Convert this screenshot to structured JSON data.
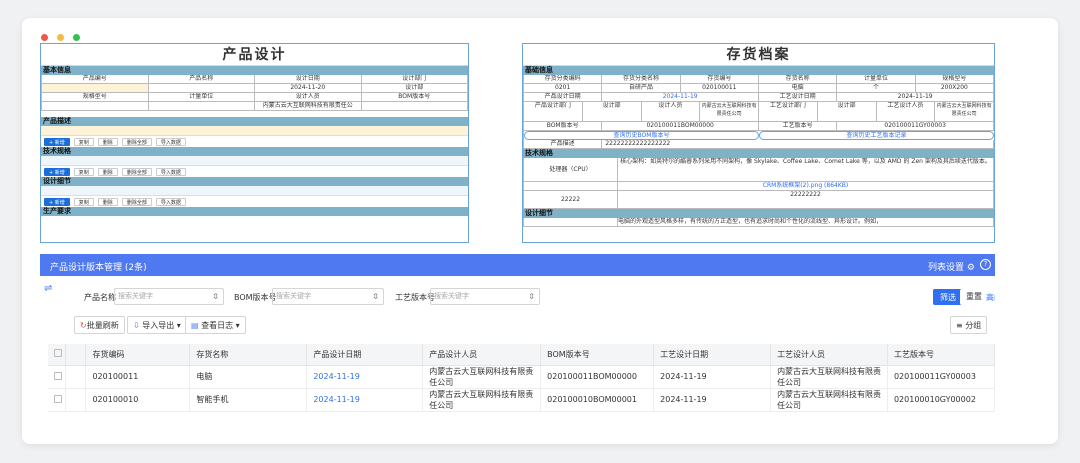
{
  "left_form": {
    "title": "产品设计",
    "basic_label": "基本信息",
    "headers1": [
      "产品编号",
      "产品名称",
      "设计日期",
      "设计部门"
    ],
    "date": "2024-11-20",
    "dept": "设计部",
    "headers2": [
      "规格型号",
      "计量单位",
      "设计人员",
      "BOM版本号"
    ],
    "designer": "内蒙古云大互联网科技有限责任公",
    "desc_label": "产品描述",
    "tech_label": "技术规格",
    "detail_label": "设计细节",
    "prod_req_label": "生产要求",
    "btn_add": "+ 新增",
    "btn_copy": "复制",
    "btn_del": "删除",
    "btn_del_all": "删除全部",
    "btn_import": "导入数据"
  },
  "right_form": {
    "title": "存货档案",
    "basic_label": "基础信息",
    "r1": [
      "存货分类编码",
      "存货分类名称",
      "存货编号",
      "存货名称",
      "计量单位",
      "规格型号"
    ],
    "r2": [
      "0201",
      "自研产品",
      "020100011",
      "电脑",
      "个",
      "200X200"
    ],
    "design_date_label": "产品设计日期",
    "design_date": "2024-11-19",
    "craft_date_label": "工艺设计日期",
    "craft_date": "2024-11-19",
    "r4": [
      "产品设计部门",
      "设计部",
      "设计人员",
      "内蒙古云大互联网科技有限责任公司",
      "工艺设计部门",
      "设计部",
      "工艺设计人员",
      "内蒙古云大互联网科技有限责任公司"
    ],
    "bom_label": "BOM版本号",
    "bom": "020100011BOM00000",
    "craft_ver_label": "工艺版本号",
    "craft_ver": "020100011GY00003",
    "hist_bom": "查询历史BOM版本号",
    "hist_craft": "查询历史工艺版本记录",
    "desc_label": "产品描述",
    "desc": "22222222222222222",
    "tech_label": "技术规格",
    "cpu_label": "处理器（CPU）",
    "cpu_text": "核心架构：如英特尔的酷睿系列采用不同架构，像 Skylake、Coffee Lake、Comet Lake 等，以及 AMD 的 Zen 架构及其后续迭代版本。",
    "file": "CRM系统框架(2).png (864KB)",
    "val1": "22222222",
    "val2": "22222",
    "detail_label": "设计细节",
    "detail_text": "电脑的外观造型风格多样，有传统的方正造型，也有追求时尚和个性化的流线型、异形设计。例如，"
  },
  "panel": {
    "title": "产品设计版本管理 (2条)",
    "settings": "列表设置",
    "help": "?",
    "filter_name_label": "产品名称",
    "filter_bom_label": "BOM版本号",
    "filter_craft_label": "工艺版本号",
    "placeholder": "搜索关键字",
    "search_btn": "筛选",
    "reset_btn": "重置",
    "advanced_link": "高级筛选",
    "refresh_btn": "批量刷新",
    "import_btn": "导入导出",
    "log_btn": "查看日志",
    "group_btn": "分组",
    "columns": [
      "存货编码",
      "存货名称",
      "产品设计日期",
      "产品设计人员",
      "BOM版本号",
      "工艺设计日期",
      "工艺设计人员",
      "工艺版本号"
    ],
    "rows": [
      [
        "020100011",
        "电脑",
        "2024-11-19",
        "内蒙古云大互联网科技有限责任公司",
        "020100011BOM00000",
        "2024-11-19",
        "内蒙古云大互联网科技有限责任公司",
        "020100011GY00003"
      ],
      [
        "020100010",
        "智能手机",
        "2024-11-19",
        "内蒙古云大互联网科技有限责任公司",
        "020100010BOM00001",
        "2024-11-19",
        "内蒙古云大互联网科技有限责任公司",
        "020100010GY00002"
      ]
    ]
  }
}
